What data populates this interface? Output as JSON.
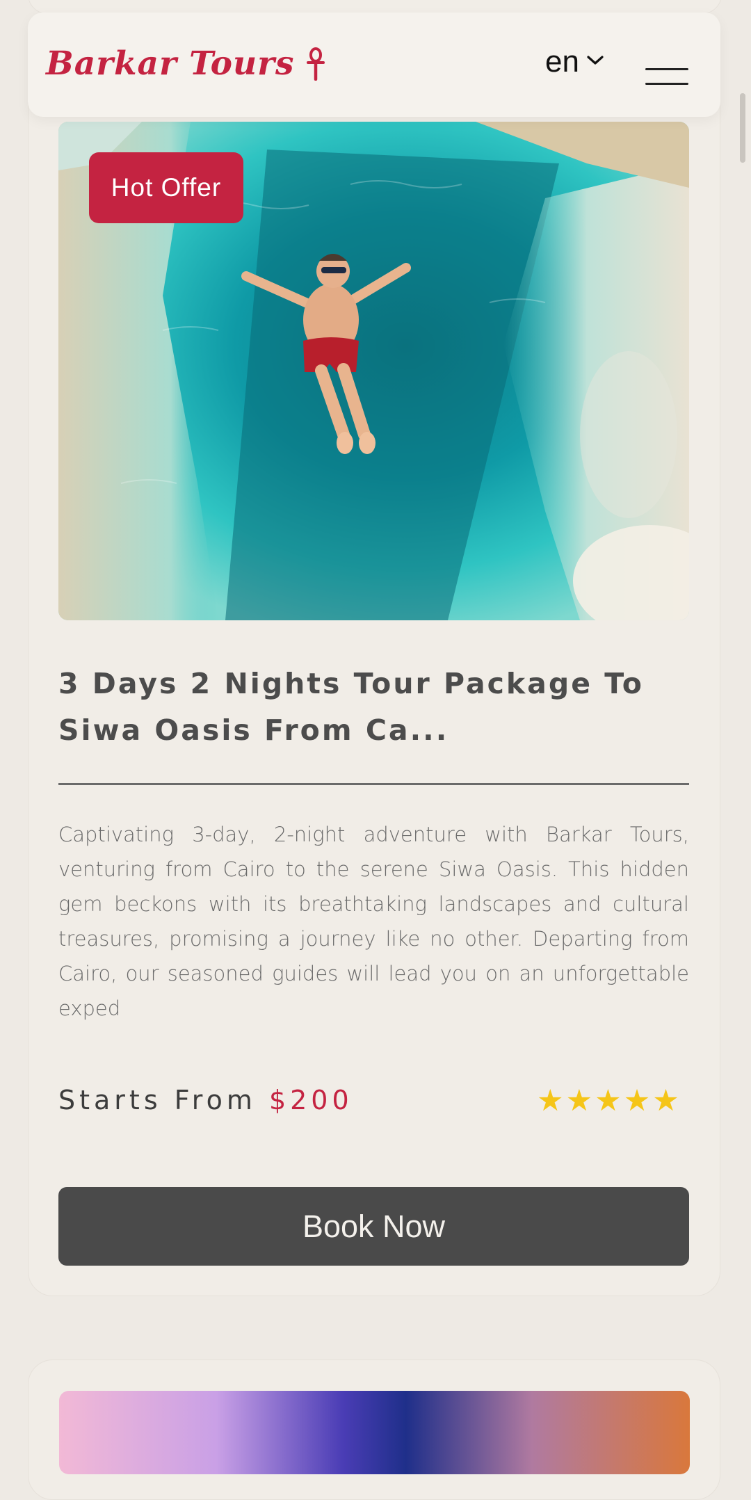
{
  "header": {
    "logo_text": "Barkar Tours",
    "logo_icon": "ankh-icon",
    "language": "en",
    "menu_icon": "hamburger-menu-icon"
  },
  "tour": {
    "badge": "Hot Offer",
    "title": "3 Days 2 Nights Tour Package To Siwa Oasis From Ca...",
    "description": "Captivating 3-day, 2-night adventure with Barkar Tours, venturing from Cairo to the serene Siwa Oasis. This hidden gem beckons with its breathtaking landscapes and cultural treasures, promising a journey like no other. Departing from Cairo, our seasoned guides will lead you on an unforgettable exped",
    "price_label": "Starts From",
    "price_value": "$200",
    "rating": 5,
    "rating_max": 5,
    "button_label": "Book Now"
  },
  "colors": {
    "brand": "#c42341",
    "star": "#f5c518",
    "button_bg": "#4a4a4a",
    "page_bg": "#eeeae4"
  }
}
